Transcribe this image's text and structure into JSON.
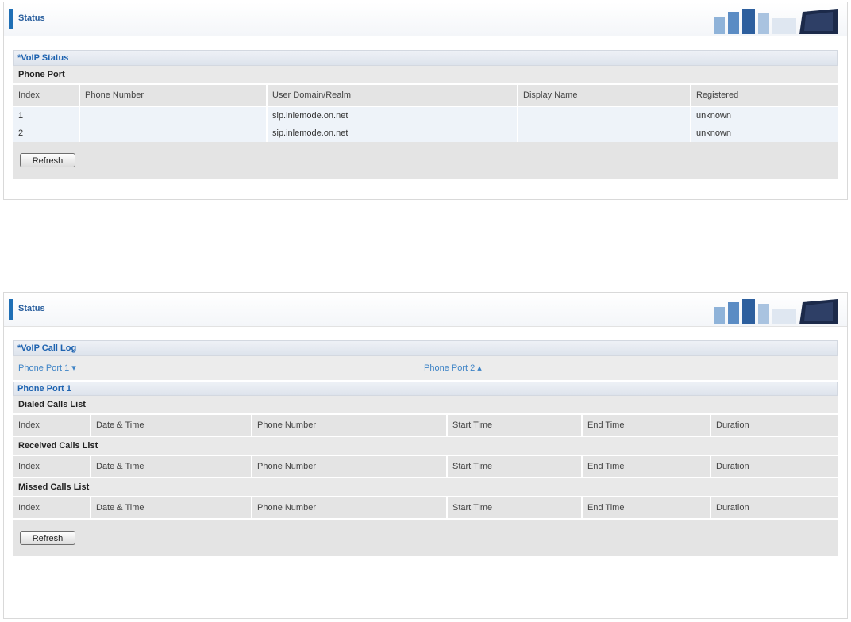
{
  "status_panel": {
    "header_title": "Status",
    "section_title": "*VoIP Status",
    "subheading": "Phone Port",
    "columns": [
      "Index",
      "Phone Number",
      "User Domain/Realm",
      "Display Name",
      "Registered"
    ],
    "rows": [
      [
        "1",
        "",
        "sip.inlemode.on.net",
        "",
        "unknown"
      ],
      [
        "2",
        "",
        "sip.inlemode.on.net",
        "",
        "unknown"
      ]
    ],
    "refresh_label": "Refresh"
  },
  "calllog_panel": {
    "header_title": "Status",
    "section_title": "*VoIP Call Log",
    "port_links": [
      "Phone Port 1 ▾",
      "Phone Port 2 ▴"
    ],
    "port_title": "Phone Port 1",
    "dialed_title": "Dialed Calls List",
    "received_title": "Received Calls List",
    "missed_title": "Missed Calls List",
    "columns": [
      "Index",
      "Date & Time",
      "Phone Number",
      "Start Time",
      "End Time",
      "Duration"
    ],
    "refresh_label": "Refresh"
  },
  "icons": {
    "logo": "brand-logo-icon"
  },
  "colors": {
    "accent": "#1f6fb5",
    "link": "#3d83c6"
  }
}
